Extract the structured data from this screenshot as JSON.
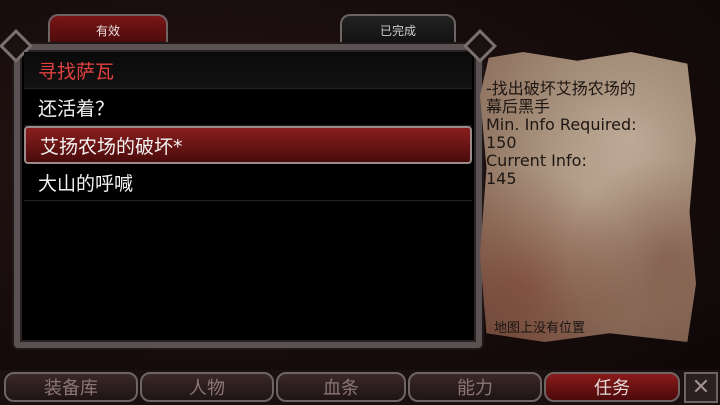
{
  "tabs": {
    "active_label": "有效",
    "completed_label": "已完成"
  },
  "quests": [
    {
      "label": "寻找萨瓦",
      "state": "active"
    },
    {
      "label": "还活着？",
      "state": "normal"
    },
    {
      "label": "艾扬农场的破坏*",
      "state": "selected"
    },
    {
      "label": "大山的呼喊",
      "state": "normal"
    }
  ],
  "detail": {
    "line1": "-找出破坏艾扬农场的",
    "line2": "幕后黑手",
    "min_info_label": "Min. Info Required:",
    "min_info_value": "150",
    "current_info_label": "Current Info:",
    "current_info_value": "145",
    "location_note": "地图上没有位置"
  },
  "bottom_tabs": [
    {
      "label": "装备库"
    },
    {
      "label": "人物"
    },
    {
      "label": "血条"
    },
    {
      "label": "能力"
    },
    {
      "label": "任务"
    }
  ],
  "close_symbol": "✕",
  "colors": {
    "active_quest": "#e24040",
    "selected_row": "#8a1e1e",
    "parchment": "#a38d78"
  }
}
